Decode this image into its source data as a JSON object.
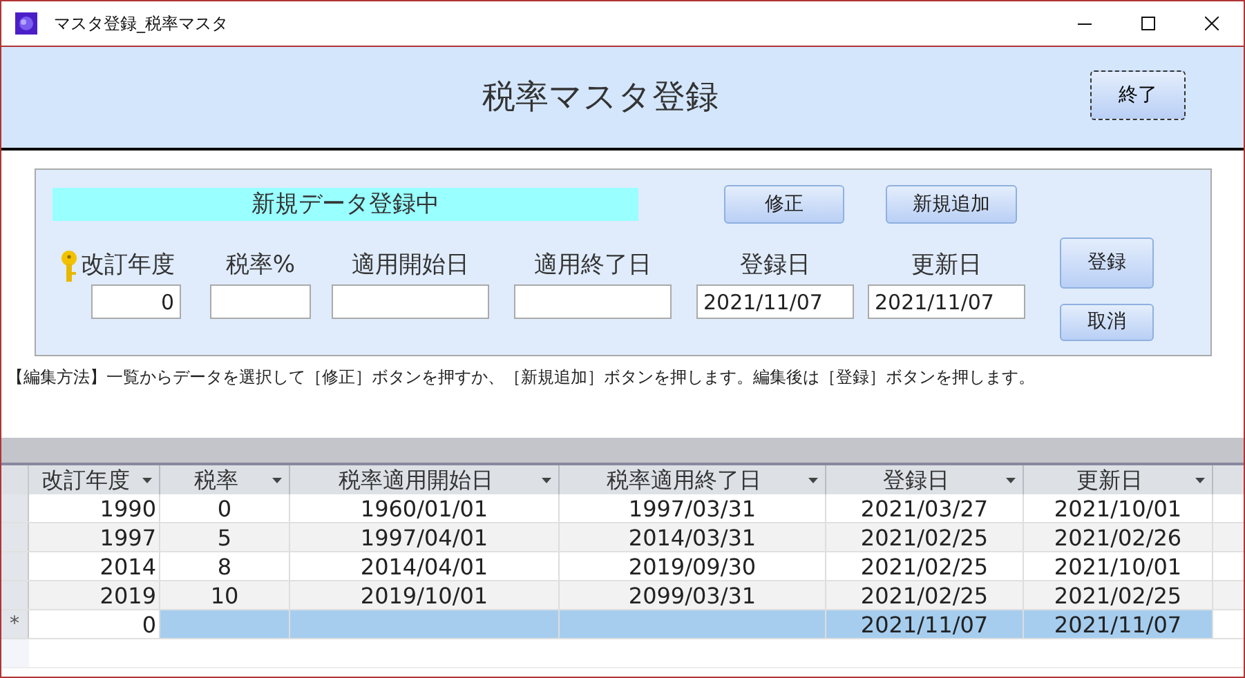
{
  "window": {
    "title": "マスタ登録_税率マスタ"
  },
  "header": {
    "title": "税率マスタ登録",
    "close_button": "終了"
  },
  "form": {
    "status": "新規データ登録中",
    "top_buttons": [
      "修正",
      "新規追加"
    ],
    "fields": [
      {
        "label": "改訂年度",
        "primary_key": true,
        "value": "0",
        "kind": "number"
      },
      {
        "label": "税率%",
        "primary_key": false,
        "kind": "number"
      },
      {
        "label": "適用開始日",
        "primary_key": false,
        "kind": "date"
      },
      {
        "label": "適用終了日",
        "primary_key": false,
        "kind": "date"
      },
      {
        "label": "登録日",
        "primary_key": false,
        "value": "2021/11/07",
        "kind": "date"
      },
      {
        "label": "更新日",
        "primary_key": false,
        "value": "2021/11/07",
        "kind": "date"
      }
    ],
    "side_buttons": [
      "登録",
      "取消"
    ]
  },
  "help_text": "【編集方法】一覧からデータを選択して［修正］ボタンを押すか、［新規追加］ボタンを押します。編集後は［登録］ボタンを押します。",
  "table": {
    "columns": [
      "改訂年度",
      "税率",
      "税率適用開始日",
      "税率適用終了日",
      "登録日",
      "更新日"
    ],
    "rows": [
      {
        "kind": "record",
        "cells": [
          "1990",
          "0",
          "1960/01/01",
          "1997/03/31",
          "2021/03/27",
          "2021/10/01"
        ]
      },
      {
        "kind": "record",
        "cells": [
          "1997",
          "5",
          "1997/04/01",
          "2014/03/31",
          "2021/02/25",
          "2021/02/26"
        ]
      },
      {
        "kind": "record",
        "cells": [
          "2014",
          "8",
          "2014/04/01",
          "2019/09/30",
          "2021/02/25",
          "2021/10/01"
        ]
      },
      {
        "kind": "record",
        "cells": [
          "2019",
          "10",
          "2019/10/01",
          "2099/03/31",
          "2021/02/25",
          "2021/02/25"
        ]
      },
      {
        "kind": "new",
        "marker": "*",
        "cells": [
          "0",
          null,
          null,
          null,
          "2021/11/07",
          "2021/11/07"
        ]
      }
    ]
  }
}
